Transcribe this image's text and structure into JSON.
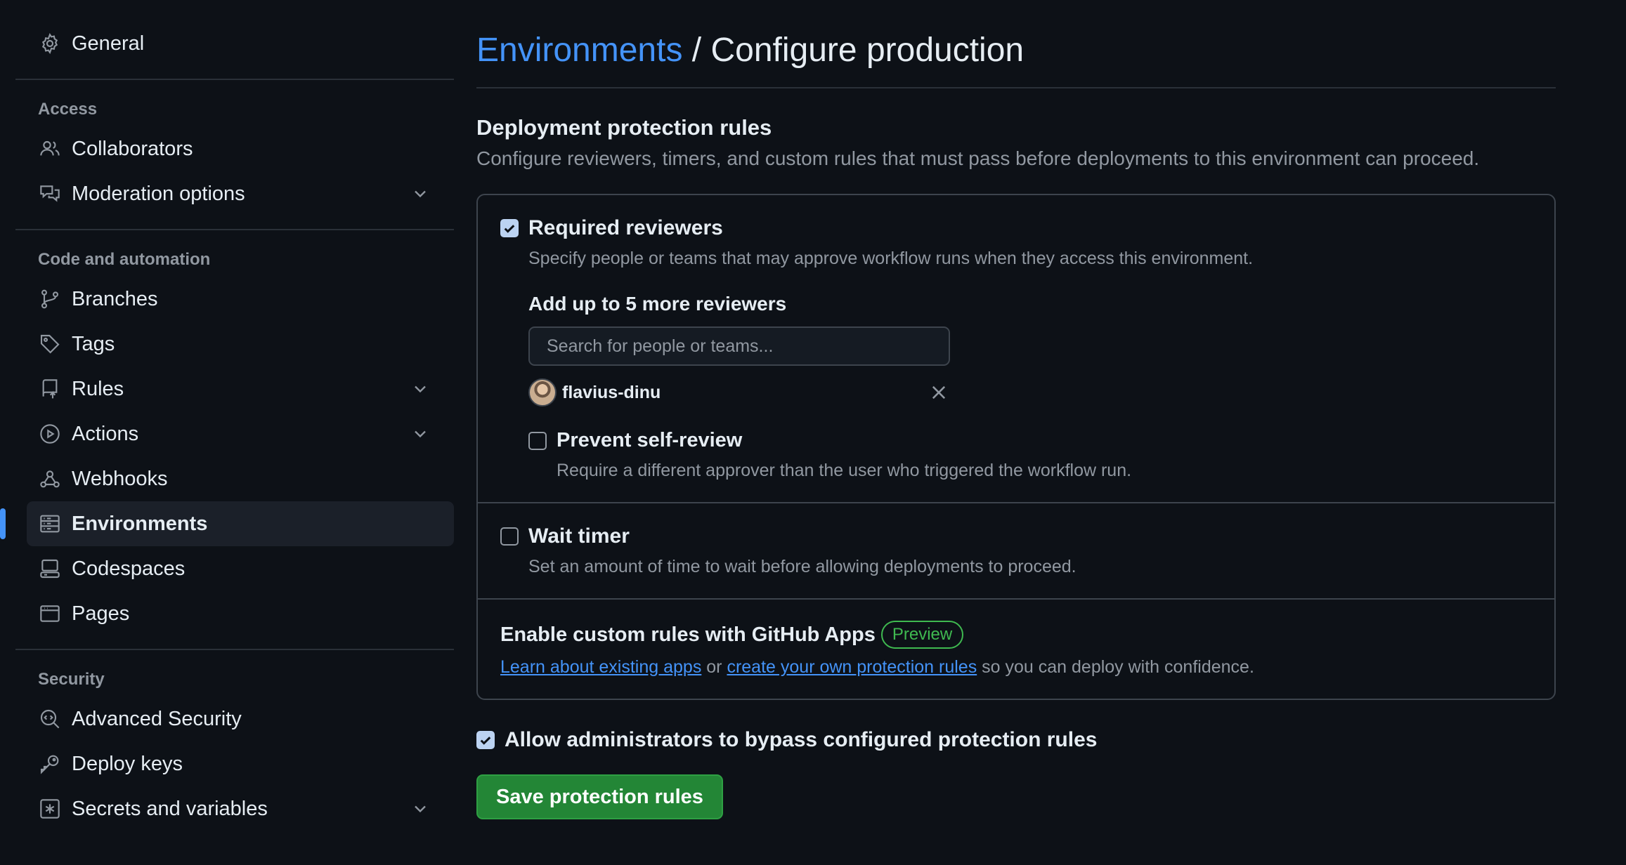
{
  "sidebar": {
    "general": {
      "label": "General",
      "icon": "gear-icon"
    },
    "access": {
      "heading": "Access",
      "items": [
        {
          "label": "Collaborators",
          "icon": "people-icon"
        },
        {
          "label": "Moderation options",
          "icon": "comment-discussion-icon"
        }
      ]
    },
    "code_automation": {
      "heading": "Code and automation",
      "items": [
        {
          "label": "Branches",
          "icon": "git-branch-icon"
        },
        {
          "label": "Tags",
          "icon": "tag-icon"
        },
        {
          "label": "Rules",
          "icon": "repo-push-icon"
        },
        {
          "label": "Actions",
          "icon": "play-icon"
        },
        {
          "label": "Webhooks",
          "icon": "webhook-icon"
        },
        {
          "label": "Environments",
          "icon": "server-icon",
          "active": true
        },
        {
          "label": "Codespaces",
          "icon": "codespaces-icon"
        },
        {
          "label": "Pages",
          "icon": "browser-icon"
        }
      ]
    },
    "security": {
      "heading": "Security",
      "items": [
        {
          "label": "Advanced Security",
          "icon": "codescan-icon"
        },
        {
          "label": "Deploy keys",
          "icon": "key-icon"
        },
        {
          "label": "Secrets and variables",
          "icon": "key-asterisk-icon"
        }
      ]
    }
  },
  "main": {
    "breadcrumb_link": "Environments",
    "title_rest": " / Configure production",
    "section_title": "Deployment protection rules",
    "section_desc": "Configure reviewers, timers, and custom rules that must pass before deployments to this environment can proceed.",
    "required_reviewers": {
      "label": "Required reviewers",
      "checked": true,
      "desc": "Specify people or teams that may approve workflow runs when they access this environment.",
      "add_title": "Add up to 5 more reviewers",
      "search_placeholder": "Search for people or teams...",
      "reviewer": "flavius-dinu",
      "prevent_self_review": {
        "label": "Prevent self-review",
        "checked": false,
        "desc": "Require a different approver than the user who triggered the workflow run."
      }
    },
    "wait_timer": {
      "label": "Wait timer",
      "checked": false,
      "desc": "Set an amount of time to wait before allowing deployments to proceed."
    },
    "custom_rules": {
      "title": "Enable custom rules with GitHub Apps",
      "badge": "Preview",
      "link1": "Learn about existing apps",
      "mid": " or ",
      "link2": "create your own protection rules",
      "tail": " so you can deploy with confidence."
    },
    "bypass": {
      "label": "Allow administrators to bypass configured protection rules",
      "checked": true
    },
    "save_label": "Save protection rules"
  },
  "colors": {
    "background": "#0d1117",
    "accent": "#4493f8",
    "success": "#238636",
    "preview_badge": "#3fb950"
  }
}
